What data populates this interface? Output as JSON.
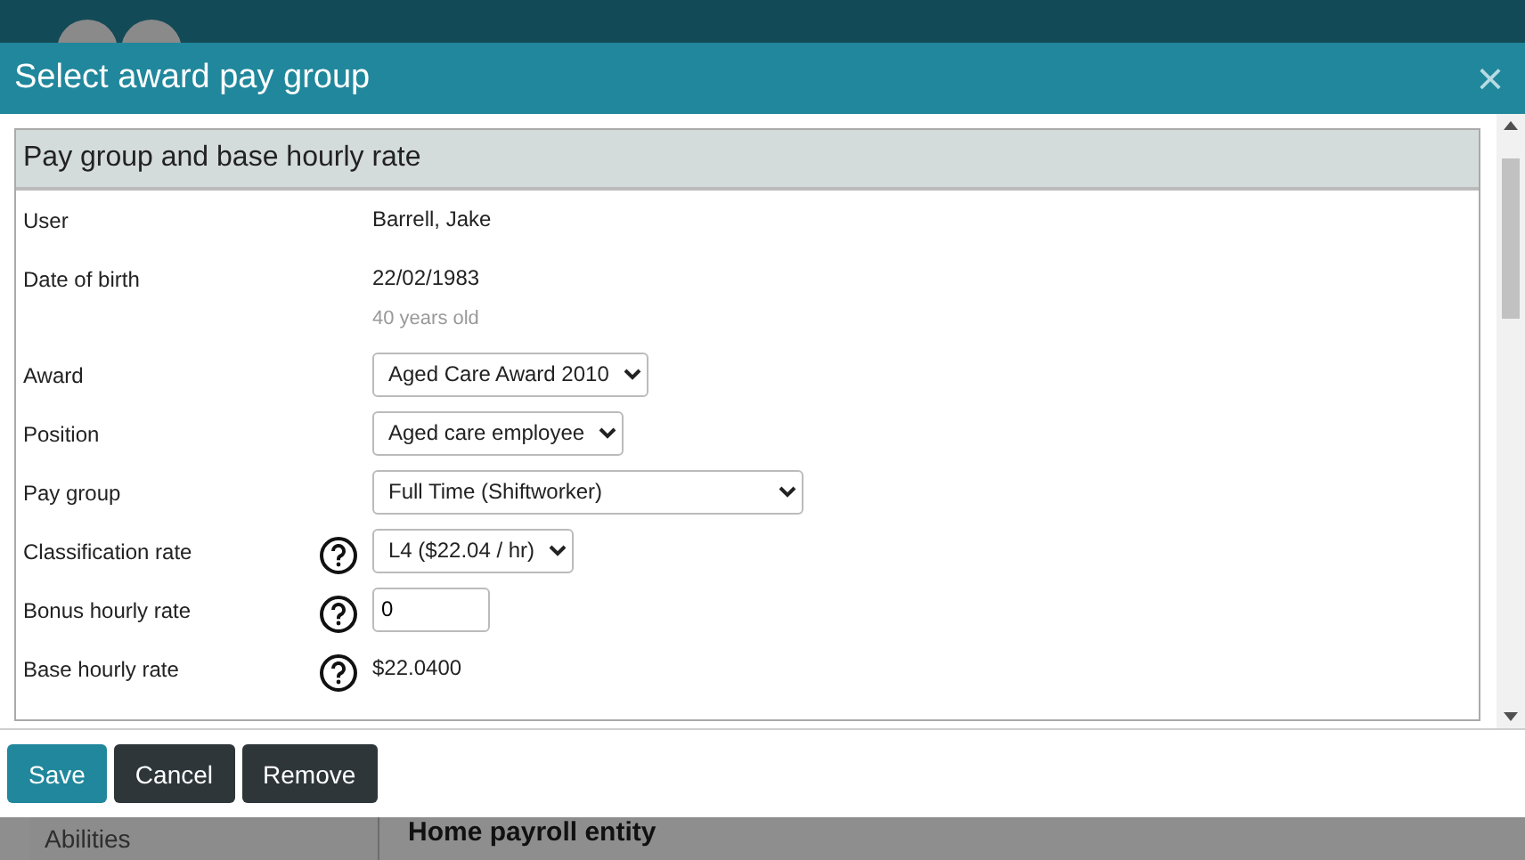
{
  "background": {
    "sidebar_item": "Abilities",
    "section_heading": "Home payroll entity"
  },
  "dialog": {
    "title": "Select award pay group",
    "close": "×",
    "section": "Pay group and base hourly rate",
    "rows": [
      {
        "label": "User",
        "kind": "text",
        "help": false,
        "value": "Barrell, Jake"
      },
      {
        "label": "Date of birth",
        "kind": "text",
        "help": false,
        "value": "22/02/1983",
        "note": "40 years old"
      },
      {
        "label": "Award",
        "kind": "select",
        "help": false,
        "value": "Aged Care Award 2010"
      },
      {
        "label": "Position",
        "kind": "select",
        "help": false,
        "value": "Aged care employee"
      },
      {
        "label": "Pay group",
        "kind": "select",
        "help": false,
        "value": "Full Time (Shiftworker)",
        "wide": true
      },
      {
        "label": "Classification rate",
        "kind": "select",
        "help": true,
        "value": "L4 ($22.04 / hr)"
      },
      {
        "label": "Bonus hourly rate",
        "kind": "input",
        "help": true,
        "value": "0"
      },
      {
        "label": "Base hourly rate",
        "kind": "text",
        "help": true,
        "value": "$22.0400"
      }
    ],
    "buttons": [
      {
        "label": "Save",
        "kind": "primary"
      },
      {
        "label": "Cancel",
        "kind": "dark"
      },
      {
        "label": "Remove",
        "kind": "dark"
      }
    ]
  }
}
